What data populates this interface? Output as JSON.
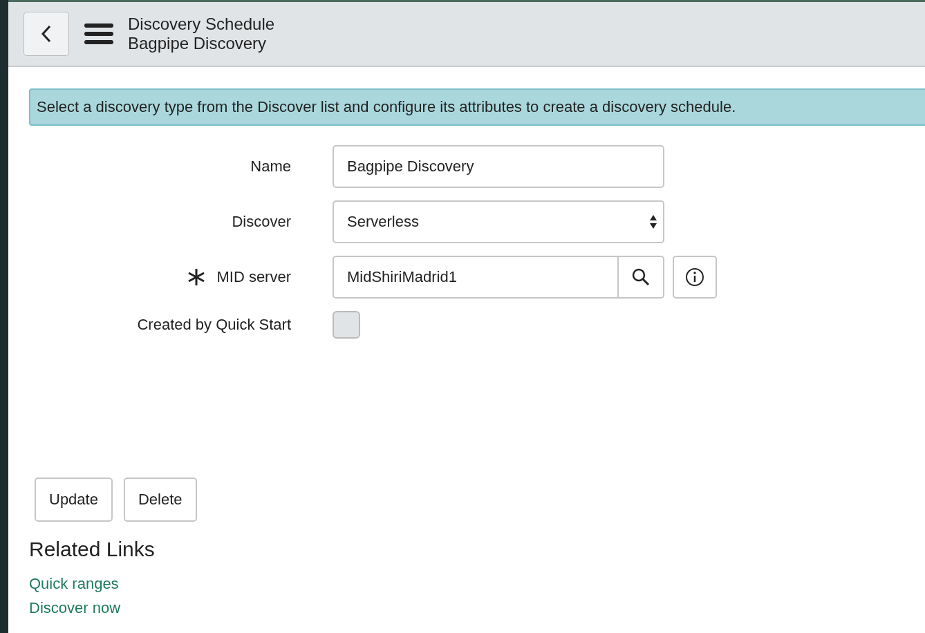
{
  "header": {
    "title": "Discovery Schedule",
    "subtitle": "Bagpipe Discovery"
  },
  "info_message": "Select a discovery type from the Discover list and configure its attributes to create a discovery schedule.",
  "fields": [
    {
      "kind": "text",
      "label": "Name",
      "value": "Bagpipe Discovery",
      "required": false
    },
    {
      "kind": "select",
      "label": "Discover",
      "value": "Serverless",
      "required": false
    },
    {
      "kind": "reference",
      "label": "MID server",
      "value": "MidShiriMadrid1",
      "required": true
    },
    {
      "kind": "checkbox",
      "label": "Created by Quick Start",
      "checked": false,
      "required": false
    }
  ],
  "buttons": [
    "Update",
    "Delete"
  ],
  "related_links": {
    "title": "Related Links",
    "links": [
      "Quick ranges",
      "Discover now"
    ]
  }
}
